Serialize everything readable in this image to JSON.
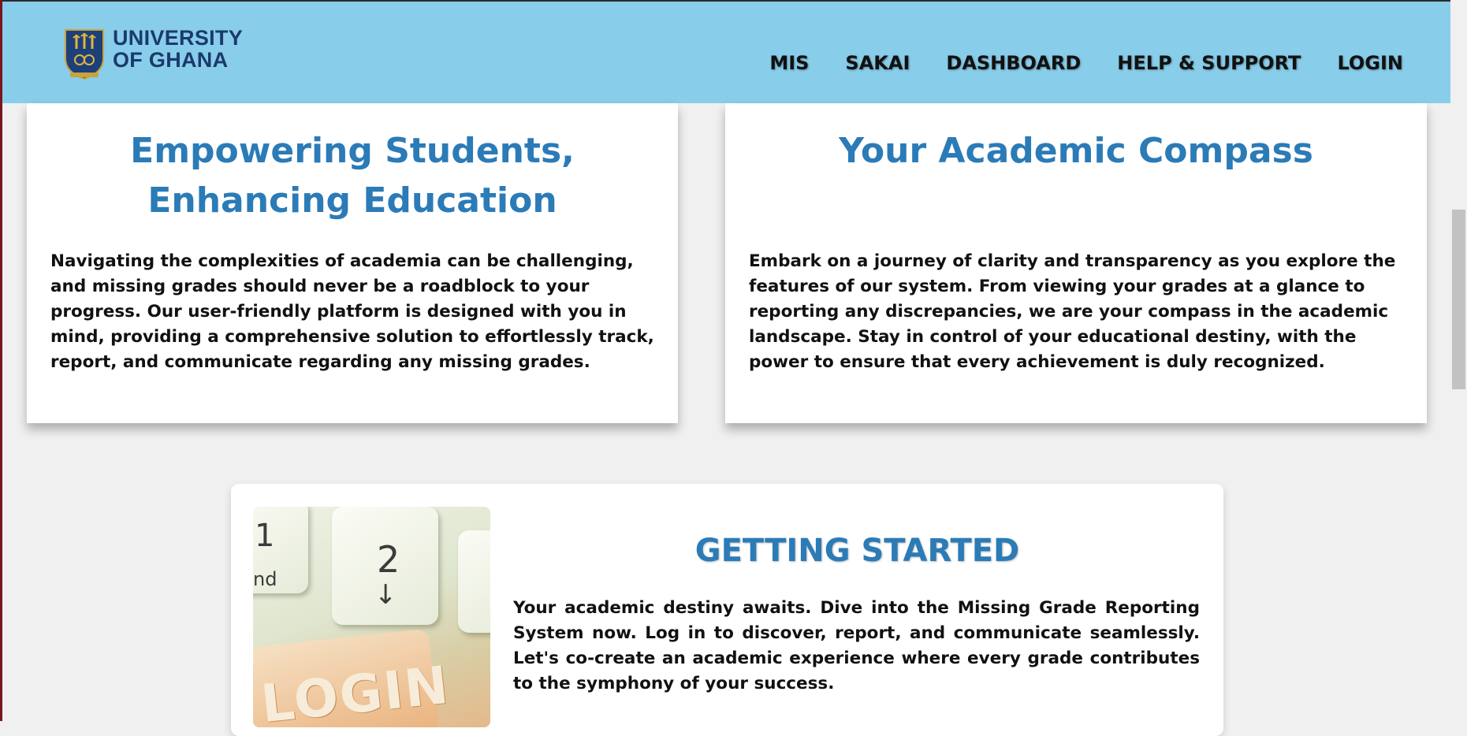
{
  "header": {
    "logo_line1": "UNIVERSITY",
    "logo_line2": "OF GHANA",
    "nav": [
      "MIS",
      "SAKAI",
      "DASHBOARD",
      "HELP & SUPPORT",
      "LOGIN"
    ]
  },
  "cards": [
    {
      "title": "Empowering Students, Enhancing Education",
      "body": "Navigating the complexities of academia can be challenging, and missing grades should never be a roadblock to your progress. Our user-friendly platform is designed with you in mind, providing a comprehensive solution to effortlessly track, report, and communicate regarding any missing grades."
    },
    {
      "title": "Your Academic Compass",
      "body": "Embark on a journey of clarity and transparency as you explore the features of our system. From viewing your grades at a glance to reporting any discrepancies, we are your compass in the academic landscape. Stay in control of your educational destiny, with the power to ensure that every achievement is duly recognized."
    }
  ],
  "getting_started": {
    "title": "GETTING STARTED",
    "body": "Your academic destiny awaits. Dive into the Missing Grade Reporting System now. Log in to discover, report, and communicate seamlessly. Let's co-create an academic experience where every grade contributes to the symphony of your success.",
    "image_keys": [
      "1",
      "nd",
      "2",
      "↓",
      "LOGIN"
    ]
  },
  "colors": {
    "header_bg": "#88cdea",
    "heading_blue": "#2b7bb7",
    "logo_navy": "#1b3a6b",
    "page_bg": "#f0f0f0"
  }
}
